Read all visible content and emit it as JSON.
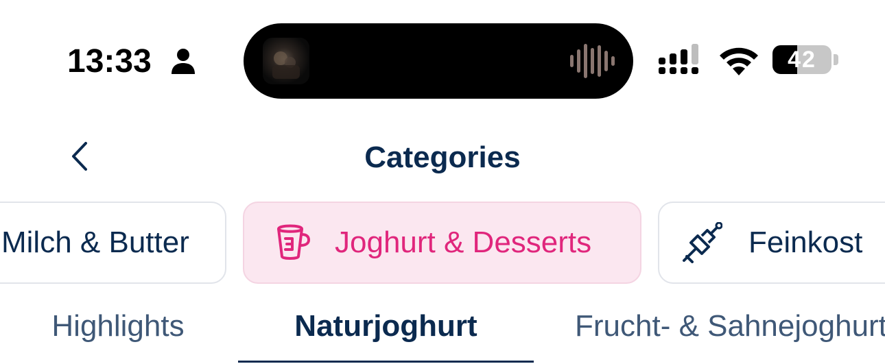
{
  "status_bar": {
    "time": "13:33",
    "battery_level": "42",
    "battery_fraction": 0.42,
    "icons": [
      "person-icon",
      "signal-icon",
      "wifi-icon",
      "battery-icon"
    ]
  },
  "header": {
    "title": "Categories",
    "back_icon": "chevron-left-icon"
  },
  "categories": [
    {
      "label": "Milch & Butter",
      "icon": "",
      "selected": false
    },
    {
      "label": "Joghurt & Desserts",
      "icon": "yogurt-cup-icon",
      "selected": true
    },
    {
      "label": "Feinkost",
      "icon": "skewer-icon",
      "selected": false
    }
  ],
  "subtabs": [
    {
      "label": "Highlights",
      "active": false
    },
    {
      "label": "Naturjoghurt",
      "active": true
    },
    {
      "label": "Frucht- & Sahnejoghurt",
      "active": false
    }
  ],
  "colors": {
    "primary_text": "#0b2a4f",
    "accent_pink": "#e0267c",
    "selected_chip_bg": "#fbe7f0"
  }
}
